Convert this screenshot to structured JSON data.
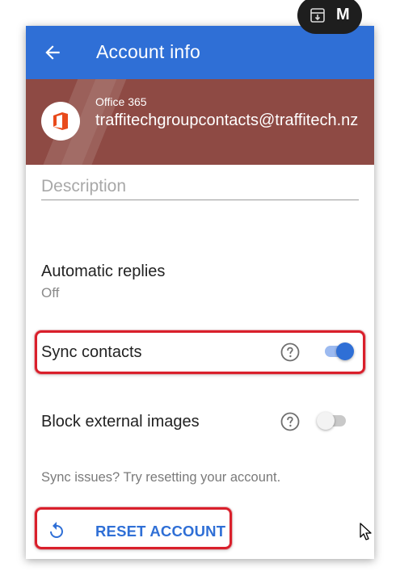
{
  "app_bar": {
    "title": "Account info",
    "back_icon": "arrow-back-icon",
    "color": "#2f6fd6"
  },
  "overlay_pill": {
    "icon": "archive-icon",
    "text": "M"
  },
  "account": {
    "type": "Office 365",
    "email": "traffitechgroupcontacts@traffitech.nz",
    "header_color": "#8e4a44",
    "logo_icon": "office-logo-icon",
    "logo_color": "#e84a1b"
  },
  "description": {
    "placeholder": "Description",
    "value": ""
  },
  "settings": {
    "automatic_replies": {
      "label": "Automatic replies",
      "value": "Off"
    },
    "sync_contacts": {
      "label": "Sync contacts",
      "enabled": true
    },
    "block_external_images": {
      "label": "Block external images",
      "enabled": false
    }
  },
  "hint": "Sync issues? Try resetting your account.",
  "reset": {
    "label": "RESET ACCOUNT",
    "icon": "reset-icon"
  },
  "colors": {
    "accent": "#2f6fd6",
    "highlight": "#d91f2b"
  }
}
